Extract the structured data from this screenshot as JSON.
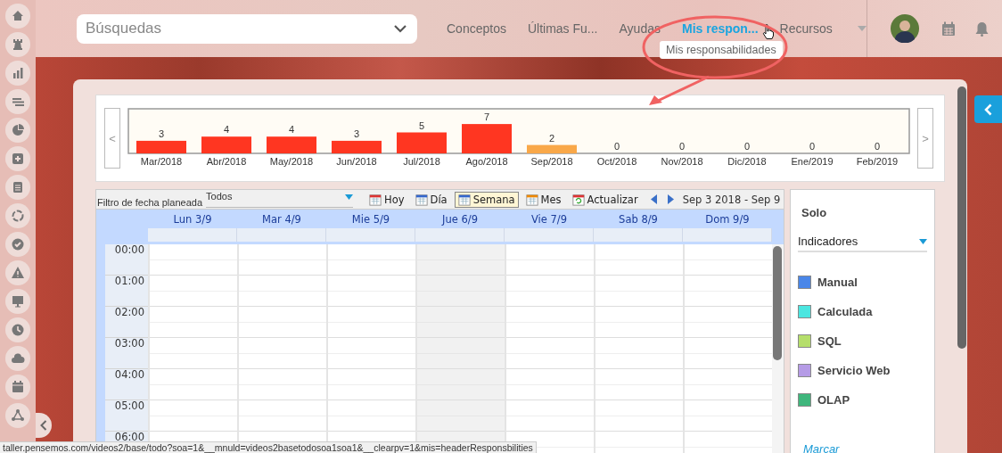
{
  "header": {
    "search": {
      "placeholder": "Búsquedas"
    },
    "nav": [
      {
        "label": "Conceptos",
        "selected": false
      },
      {
        "label": "Últimas Fu...",
        "selected": false
      },
      {
        "label": "Ayudas",
        "selected": false
      },
      {
        "label": "Mis respon...",
        "selected": true
      },
      {
        "label": "Recursos",
        "selected": false
      }
    ],
    "tooltip": "Mis responsabilidades"
  },
  "chart_panel": {
    "prev": "<",
    "next": ">",
    "chart_data": {
      "type": "bar",
      "stacked": true,
      "data_labels": true,
      "categories": [
        "Mar/2018",
        "Abr/2018",
        "May/2018",
        "Jun/2018",
        "Jul/2018",
        "Ago/2018",
        "Sep/2018",
        "Oct/2018",
        "Nov/2018",
        "Dic/2018",
        "Ene/2019",
        "Feb/2019"
      ],
      "series": [
        {
          "color": "#ff3621",
          "values": [
            3,
            4,
            4,
            3,
            5,
            7,
            null,
            0,
            0,
            0,
            0,
            0
          ]
        },
        {
          "color": "#f9a849",
          "values": [
            null,
            null,
            null,
            null,
            null,
            null,
            2,
            null,
            null,
            null,
            null,
            null
          ]
        }
      ]
    }
  },
  "calendar": {
    "filter_label": "Filtro de fecha planeada",
    "filter_value": "Todos",
    "buttons": [
      {
        "kind": "today",
        "label": "Hoy",
        "selected": false
      },
      {
        "kind": "day",
        "label": "Día",
        "selected": false
      },
      {
        "kind": "week",
        "label": "Semana",
        "selected": true
      },
      {
        "kind": "month",
        "label": "Mes",
        "selected": false
      },
      {
        "kind": "refresh",
        "label": "Actualizar",
        "selected": false
      }
    ],
    "range": "Sep 3 2018 - Sep 9",
    "days": [
      {
        "label": "Lun 3/9",
        "today": false
      },
      {
        "label": "Mar 4/9",
        "today": false
      },
      {
        "label": "Mie 5/9",
        "today": false
      },
      {
        "label": "Jue 6/9",
        "today": true
      },
      {
        "label": "Vie 7/9",
        "today": false
      },
      {
        "label": "Sab 8/9",
        "today": false
      },
      {
        "label": "Dom 9/9",
        "today": false
      }
    ],
    "hours": [
      "00:00",
      "01:00",
      "02:00",
      "03:00",
      "04:00",
      "05:00",
      "06:00"
    ]
  },
  "legend": {
    "title": "Solo",
    "filter": "Indicadores",
    "items": [
      {
        "label": "Manual",
        "color": "#4a86e8"
      },
      {
        "label": "Calculada",
        "color": "#4be6e0"
      },
      {
        "label": "SQL",
        "color": "#b5de6b"
      },
      {
        "label": "Servicio Web",
        "color": "#b59be6"
      },
      {
        "label": "OLAP",
        "color": "#3fb67c"
      }
    ],
    "link": "Marcar"
  },
  "status_bar": "taller.pensemos.com/videos2/base/todo?soa=1&__mnuld=videos2basetodosoa1soa1&__clearpv=1&mis=headerResponsbilities"
}
